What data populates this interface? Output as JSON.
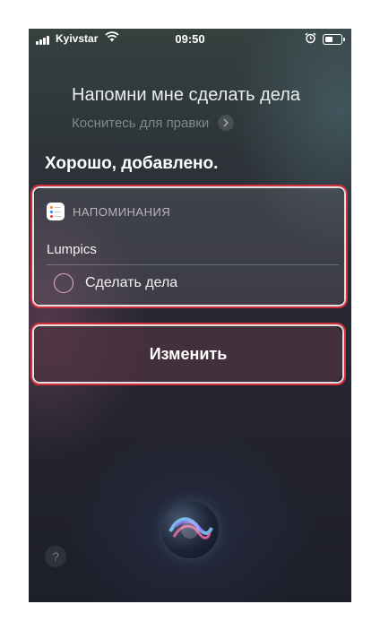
{
  "status": {
    "carrier": "Kyivstar",
    "time": "09:50",
    "battery_level": 0.5
  },
  "siri": {
    "query": "Напомни мне сделать дела",
    "edit_hint": "Коснитесь для правки",
    "response": "Хорошо, добавлено."
  },
  "reminder_card": {
    "app_name": "НАПОМИНАНИЯ",
    "list_name": "Lumpics",
    "item": "Сделать дела"
  },
  "actions": {
    "edit_label": "Изменить"
  },
  "help": {
    "label": "?"
  },
  "colors": {
    "highlight": "#d32f3a",
    "checkbox": "#e8acc3",
    "button": "#50344a"
  },
  "icons": [
    "signal-icon",
    "wifi-icon",
    "alarm-icon",
    "battery-icon",
    "chevron-right-icon",
    "reminders-app-icon",
    "siri-orb-icon"
  ]
}
